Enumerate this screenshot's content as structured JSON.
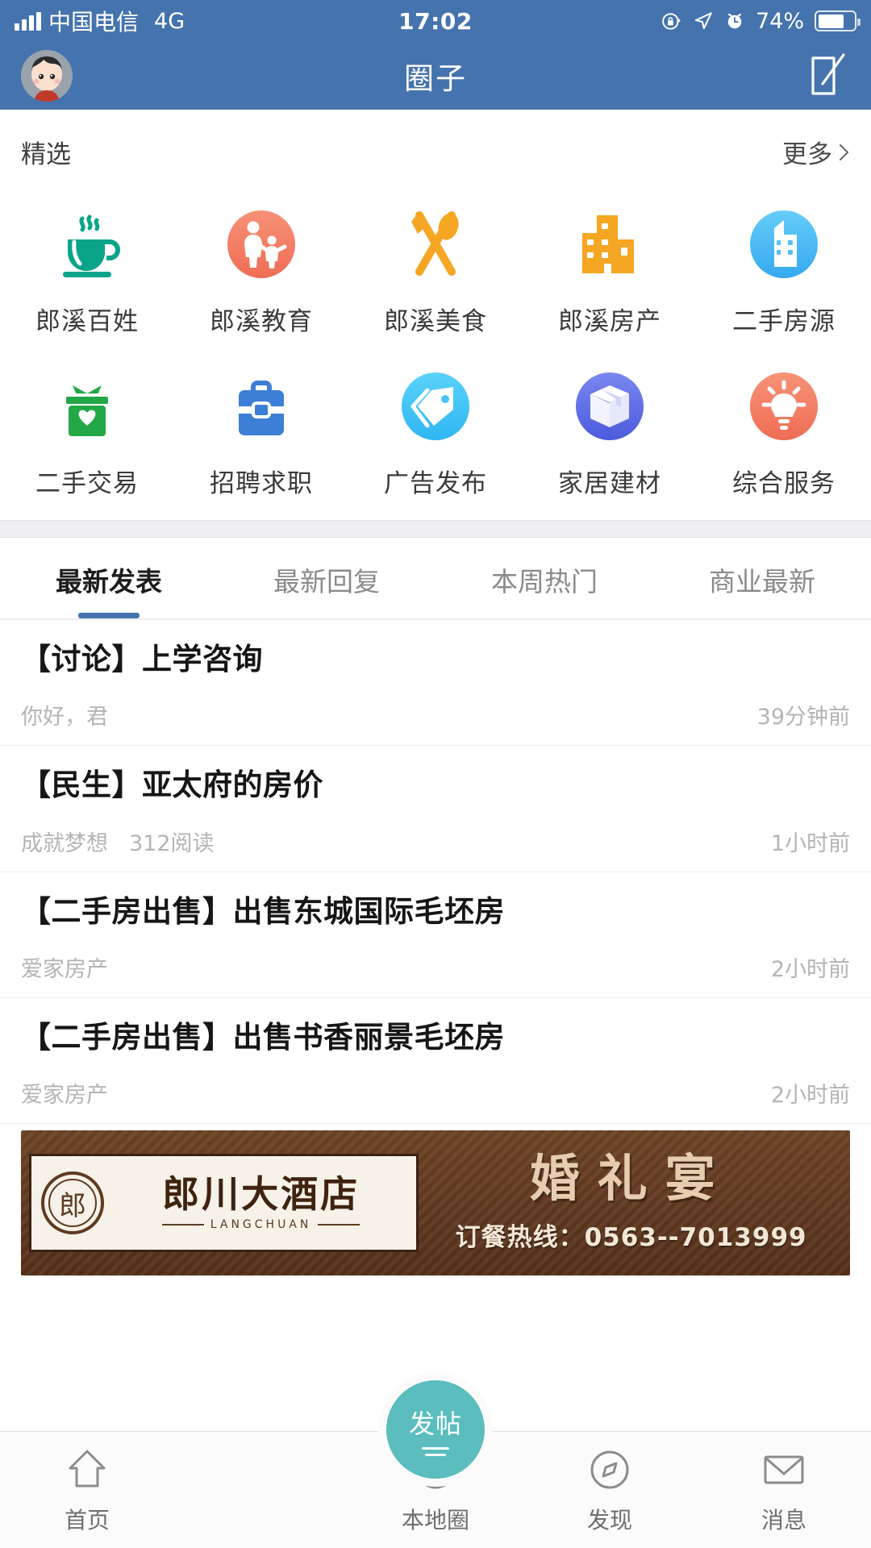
{
  "status_bar": {
    "carrier": "中国电信",
    "network": "4G",
    "time": "17:02",
    "battery_percent": "74%",
    "icons": [
      "signal-bars-icon",
      "rotation-lock-icon",
      "location-arrow-icon",
      "alarm-clock-icon",
      "battery-icon"
    ]
  },
  "nav_bar": {
    "title": "圈子",
    "avatar_name": "user-avatar",
    "compose_icon": "compose-pencil-icon"
  },
  "featured": {
    "title": "精选",
    "more_label": "更多",
    "more_icon": "chevron-right-icon",
    "items": [
      {
        "label": "郎溪百姓",
        "icon": "coffee-cup-icon",
        "color": "#0aa48a",
        "shape": "plain"
      },
      {
        "label": "郎溪教育",
        "icon": "parent-child-icon",
        "color": "#f4836a",
        "shape": "circle"
      },
      {
        "label": "郎溪美食",
        "icon": "fork-spoon-icon",
        "color": "#f5a623",
        "shape": "plain"
      },
      {
        "label": "郎溪房产",
        "icon": "building-icon",
        "color": "#f5a623",
        "shape": "plain"
      },
      {
        "label": "二手房源",
        "icon": "house-circle-icon",
        "color": "#44b9f5",
        "shape": "circle"
      },
      {
        "label": "二手交易",
        "icon": "money-box-icon",
        "color": "#22a845",
        "shape": "plain"
      },
      {
        "label": "招聘求职",
        "icon": "briefcase-icon",
        "color": "#3d7fd6",
        "shape": "plain"
      },
      {
        "label": "广告发布",
        "icon": "price-tag-icon",
        "color": "#3ec3f5",
        "shape": "circle"
      },
      {
        "label": "家居建材",
        "icon": "package-box-icon",
        "color": "#5b6ee8",
        "shape": "circle"
      },
      {
        "label": "综合服务",
        "icon": "lightbulb-icon",
        "color": "#f4836a",
        "shape": "circle"
      }
    ]
  },
  "feed_tabs": {
    "active_index": 0,
    "items": [
      {
        "label": "最新发表"
      },
      {
        "label": "最新回复"
      },
      {
        "label": "本周热门"
      },
      {
        "label": "商业最新"
      }
    ],
    "active_color": "#4573ae"
  },
  "posts": [
    {
      "title": "【讨论】上学咨询",
      "author": "你好，君",
      "views": "",
      "time": "39分钟前"
    },
    {
      "title": "【民生】亚太府的房价",
      "author": "成就梦想",
      "views": "312阅读",
      "time": "1小时前"
    },
    {
      "title": "【二手房出售】出售东城国际毛坯房",
      "author": "爱家房产",
      "views": "",
      "time": "2小时前"
    },
    {
      "title": "【二手房出售】出售书香丽景毛坯房",
      "author": "爱家房产",
      "views": "",
      "time": "2小时前"
    }
  ],
  "banner": {
    "hotel_cn": "郎川大酒店",
    "hotel_en": "LANGCHUAN",
    "seal_text": "郎",
    "headline": "婚礼宴",
    "hotline": "订餐热线：0563--7013999"
  },
  "tab_bar": {
    "fab": {
      "label": "发帖",
      "icon": "compose-lines-icon",
      "color": "#5bbdbd"
    },
    "items": [
      {
        "label": "首页",
        "icon": "home-icon"
      },
      {
        "label": "本地圈",
        "icon": "aperture-icon"
      },
      {
        "label": "发现",
        "icon": "compass-icon"
      },
      {
        "label": "消息",
        "icon": "envelope-icon"
      }
    ]
  }
}
